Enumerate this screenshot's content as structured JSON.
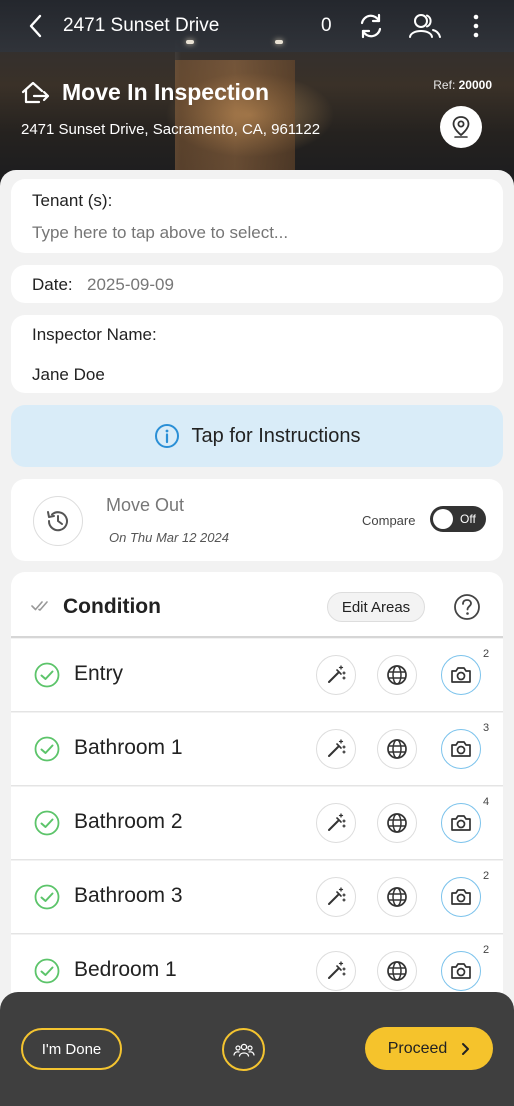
{
  "header": {
    "title": "2471 Sunset Drive",
    "count": "0",
    "inspection_type": "Move In Inspection",
    "ref_label": "Ref:",
    "ref_value": "20000",
    "address": "2471 Sunset Drive, Sacramento, CA, 961122"
  },
  "tenant": {
    "label": "Tenant (s):",
    "placeholder": "Type here to tap above to select..."
  },
  "date": {
    "label": "Date:",
    "value": "2025-09-09"
  },
  "inspector": {
    "label": "Inspector Name:",
    "value": "Jane Doe"
  },
  "instructions": {
    "label": "Tap for Instructions"
  },
  "move_out": {
    "title": "Move Out",
    "date": "On Thu Mar 12 2024",
    "compare_label": "Compare",
    "toggle_label": "Off"
  },
  "condition": {
    "title": "Condition",
    "edit_areas_label": "Edit Areas"
  },
  "rooms": [
    {
      "name": "Entry",
      "photos": "2"
    },
    {
      "name": "Bathroom 1",
      "photos": "3"
    },
    {
      "name": "Bathroom 2",
      "photos": "4"
    },
    {
      "name": "Bathroom 3",
      "photos": "2"
    },
    {
      "name": "Bedroom 1",
      "photos": "2"
    }
  ],
  "footer": {
    "done_label": "I'm Done",
    "proceed_label": "Proceed"
  },
  "colors": {
    "accent": "#f5c32c",
    "check_green": "#5cc46a",
    "info_blue": "#2a8fd6",
    "camera_border": "#7cc3ec"
  }
}
